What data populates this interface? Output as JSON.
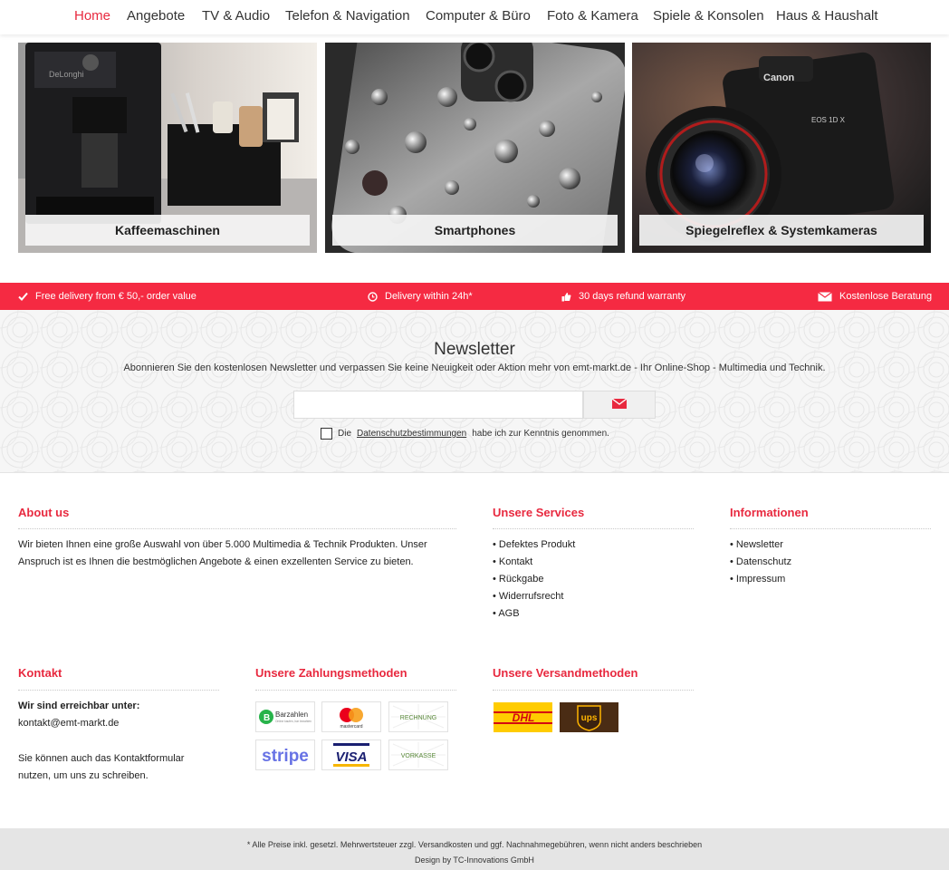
{
  "nav": {
    "items": [
      {
        "label": "Home",
        "active": true
      },
      {
        "label": "Angebote"
      },
      {
        "label": "TV & Audio"
      },
      {
        "label": "Telefon & Navigation"
      },
      {
        "label": "Computer & Büro"
      },
      {
        "label": "Foto & Kamera"
      },
      {
        "label": "Spiele & Konsolen"
      },
      {
        "label": "Haus & Haushalt"
      }
    ]
  },
  "categories": [
    {
      "label": "Kaffeemaschinen",
      "image_text": "DeLonghi"
    },
    {
      "label": "Smartphones"
    },
    {
      "label": "Spiegelreflex & Systemkameras",
      "image_text": "Canon",
      "image_text_2": "EOS 1D X"
    }
  ],
  "features": [
    {
      "icon": "check-icon",
      "text": "Free delivery from € 50,- order value"
    },
    {
      "icon": "clock-icon",
      "text": "Delivery within 24h*"
    },
    {
      "icon": "thumbs-up-icon",
      "text": "30 days refund warranty"
    },
    {
      "icon": "envelope-icon",
      "text": "Kostenlose Beratung"
    }
  ],
  "newsletter": {
    "title": "Newsletter",
    "subtitle": "Abonnieren Sie den kostenlosen Newsletter und verpassen Sie keine Neuigkeit oder Aktion mehr von emt-markt.de - Ihr Online-Shop - Multimedia und Technik.",
    "email_value": "",
    "email_placeholder": "",
    "consent_prefix": "Die",
    "consent_link": "Datenschutzbestimmungen",
    "consent_suffix": "habe ich zur Kenntnis genommen."
  },
  "footer": {
    "about": {
      "title": "About us",
      "text": "Wir bieten Ihnen eine große Auswahl von über 5.000 Multimedia & Technik Produkten. Unser Anspruch ist es Ihnen die bestmöglichen Angebote & einen exzellenten Service zu bieten."
    },
    "services": {
      "title": "Unsere Services",
      "items": [
        "Defektes Produkt",
        "Kontakt",
        "Rückgabe",
        "Widerrufsrecht",
        "AGB"
      ]
    },
    "info": {
      "title": "Informationen",
      "items": [
        "Newsletter",
        "Datenschutz",
        "Impressum"
      ]
    },
    "contact": {
      "title": "Kontakt",
      "reach_label": "Wir sind erreichbar unter:",
      "email": "kontakt@emt-markt.de",
      "form_text": "Sie können auch das Kontaktformular nutzen, um uns zu schreiben."
    },
    "payment": {
      "title": "Unsere Zahlungsmethoden",
      "methods": [
        {
          "name": "Barzahlen",
          "sub": "Online kaufen, bar bezahlen",
          "icon": "barzahlen-logo"
        },
        {
          "name": "mastercard",
          "icon": "mastercard-logo"
        },
        {
          "name": "RECHNUNG",
          "icon": "rechnung-badge"
        },
        {
          "name": "stripe",
          "icon": "stripe-logo"
        },
        {
          "name": "VISA",
          "icon": "visa-logo"
        },
        {
          "name": "VORKASSE",
          "icon": "vorkasse-badge"
        }
      ]
    },
    "shipping": {
      "title": "Unsere Versandmethoden",
      "methods": [
        {
          "name": "DHL",
          "icon": "dhl-logo"
        },
        {
          "name": "ups",
          "icon": "ups-logo"
        }
      ]
    }
  },
  "bottom": {
    "disclaimer": "* Alle Preise inkl. gesetzl. Mehrwertsteuer zzgl. Versandkosten und ggf. Nachnahmegebühren, wenn nicht anders beschrieben",
    "credit": "Design by TC-Innovations GmbH"
  },
  "colors": {
    "accent": "#e8293f",
    "feature_bar": "#f52a42",
    "dhl_yellow": "#ffcc00",
    "dhl_red": "#d40511",
    "ups_brown": "#4a2c14",
    "ups_gold": "#ffb500",
    "stripe_purple": "#6772e5",
    "visa_blue": "#1a1f71"
  }
}
